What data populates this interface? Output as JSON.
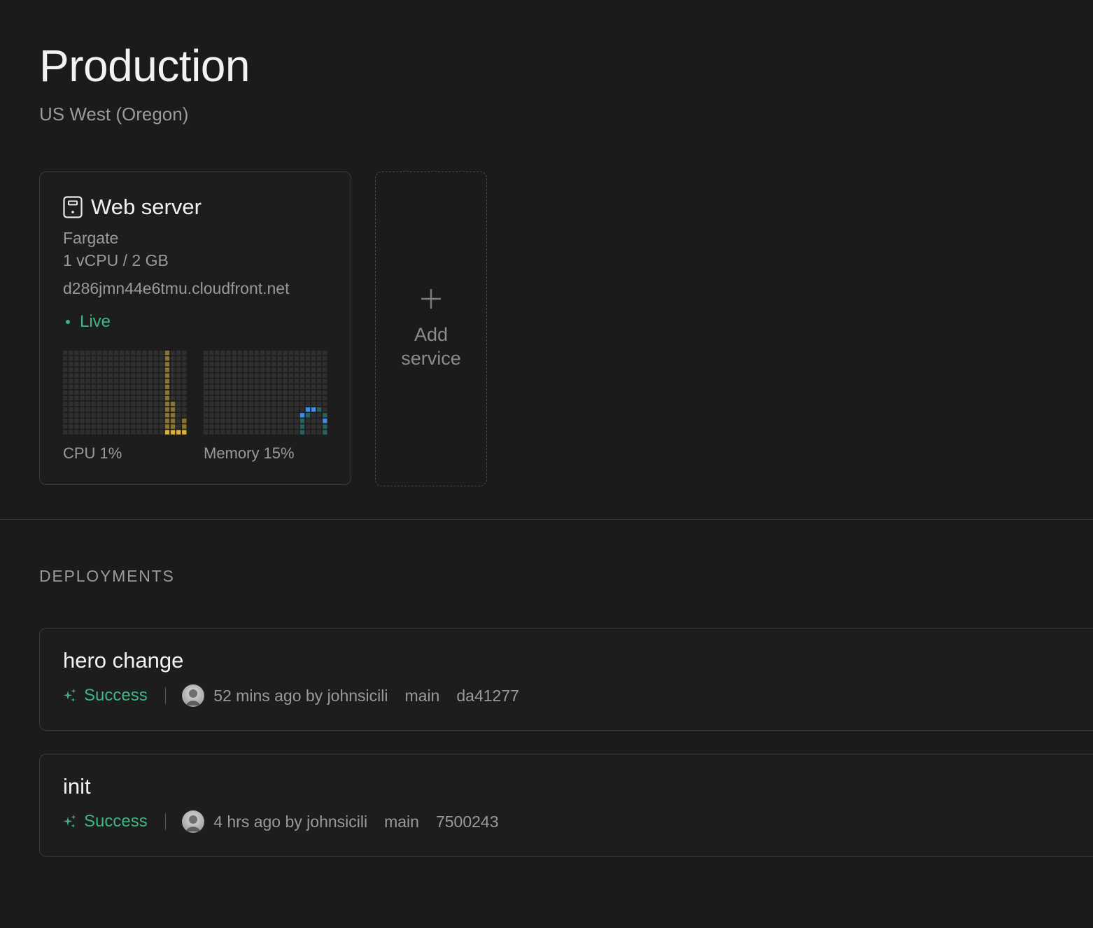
{
  "environment": {
    "title": "Production",
    "region": "US West (Oregon)"
  },
  "service": {
    "icon": "server-icon",
    "name": "Web server",
    "platform": "Fargate",
    "spec": "1 vCPU / 2 GB",
    "domain": "d286jmn44e6tmu.cloudfront.net",
    "status": "Live",
    "status_color": "#3cb583",
    "cpu": {
      "label": "CPU 1%",
      "color": "#d9b03c",
      "dim_color": "#8a7434",
      "value_percent": 1
    },
    "memory": {
      "label": "Memory 15%",
      "color": "#3f8de8",
      "dim_color": "#28625e",
      "value_percent": 15
    }
  },
  "add_service": {
    "icon": "plus-icon",
    "label": "Add service"
  },
  "deployments": {
    "heading": "DEPLOYMENTS",
    "items": [
      {
        "title": "hero change",
        "status": "Success",
        "time_author": "52 mins ago by johnsicili",
        "branch": "main",
        "commit": "da41277"
      },
      {
        "title": "init",
        "status": "Success",
        "time_author": "4 hrs ago by johnsicili",
        "branch": "main",
        "commit": "7500243"
      }
    ]
  },
  "colors": {
    "background": "#1b1b1b",
    "border": "#3a3a3a",
    "success": "#3cb583",
    "muted_text": "#9a9a9a"
  }
}
